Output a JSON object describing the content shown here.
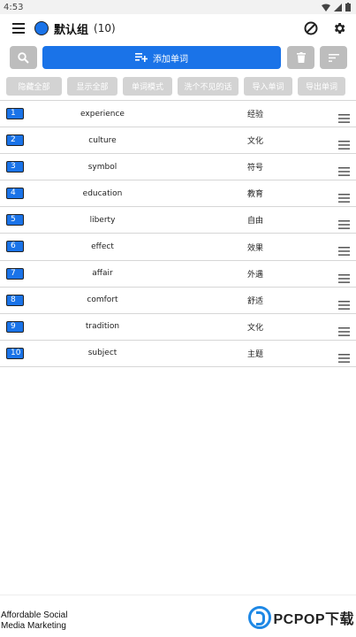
{
  "status": {
    "time": "4:53"
  },
  "header": {
    "title": "默认组",
    "count": "(10)"
  },
  "toolbar": {
    "add_label": "添加单词"
  },
  "chips": [
    "隐藏全部",
    "显示全部",
    "单词模式",
    "洗个不见的话",
    "导入单词",
    "导出单词"
  ],
  "words": [
    {
      "num": "1",
      "word": "experience",
      "meaning": "经验"
    },
    {
      "num": "2",
      "word": "culture",
      "meaning": "文化"
    },
    {
      "num": "3",
      "word": "symbol",
      "meaning": "符号"
    },
    {
      "num": "4",
      "word": "education",
      "meaning": "教育"
    },
    {
      "num": "5",
      "word": "liberty",
      "meaning": "自由"
    },
    {
      "num": "6",
      "word": "effect",
      "meaning": "效果"
    },
    {
      "num": "7",
      "word": "affair",
      "meaning": "外遇"
    },
    {
      "num": "8",
      "word": "comfort",
      "meaning": "舒适"
    },
    {
      "num": "9",
      "word": "tradition",
      "meaning": "文化"
    },
    {
      "num": "10",
      "word": "subject",
      "meaning": "主题"
    }
  ],
  "ad": {
    "text": "Affordable Social Media Marketing",
    "logo_text": "PCPOP下载"
  },
  "colors": {
    "accent": "#1a73e8",
    "chip": "#d3d3d3",
    "grey_button": "#bdbdbd"
  }
}
